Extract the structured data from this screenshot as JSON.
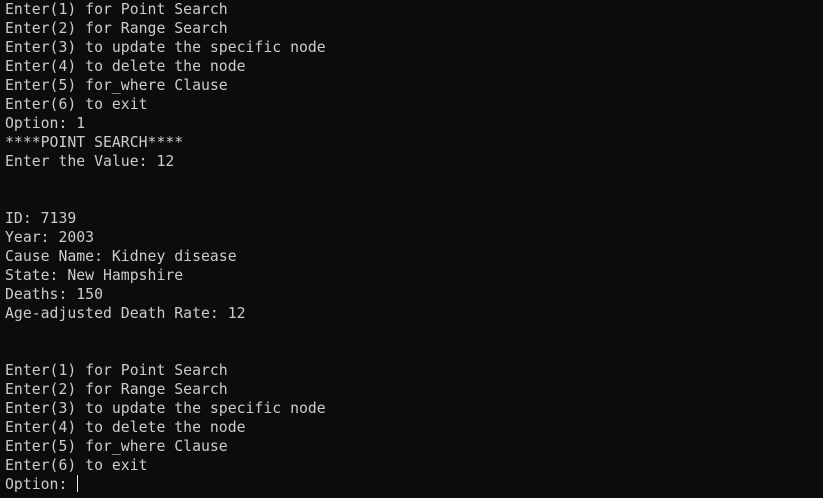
{
  "terminal": {
    "menu_first": [
      "Enter(1) for Point Search",
      "Enter(2) for Range Search",
      "Enter(3) to update the specific node",
      "Enter(4) to delete the node",
      "Enter(5) for_where Clause",
      "Enter(6) to exit"
    ],
    "option_entered": "Option: 1",
    "search_header": "****POINT SEARCH****",
    "value_prompt": "Enter the Value: 12",
    "record": [
      "ID: 7139",
      "Year: 2003",
      "Cause Name: Kidney disease",
      "State: New Hampshire",
      "Deaths: 150",
      "Age-adjusted Death Rate: 12"
    ],
    "menu_second": [
      "Enter(1) for Point Search",
      "Enter(2) for Range Search",
      "Enter(3) to update the specific node",
      "Enter(4) to delete the node",
      "Enter(5) for_where Clause",
      "Enter(6) to exit"
    ],
    "option_prompt": "Option: "
  }
}
